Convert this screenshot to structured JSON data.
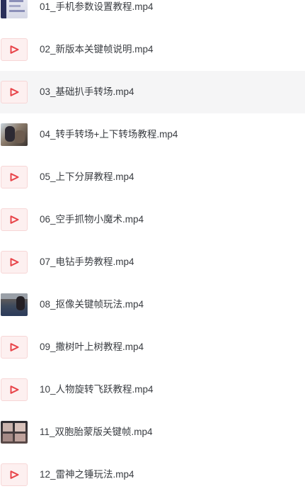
{
  "files": [
    {
      "name": "01_手机参数设置教程.mp4",
      "thumb": "photo",
      "icon": "video-thumbnail-icon"
    },
    {
      "name": "02_新版本关键帧说明.mp4",
      "thumb": "video-icon",
      "icon": "video-file-icon"
    },
    {
      "name": "03_基础扒手转场.mp4",
      "thumb": "video-icon",
      "icon": "video-file-icon",
      "selected": true
    },
    {
      "name": "04_转手转场+上下转场教程.mp4",
      "thumb": "photo",
      "icon": "video-thumbnail-icon"
    },
    {
      "name": "05_上下分屏教程.mp4",
      "thumb": "video-icon",
      "icon": "video-file-icon"
    },
    {
      "name": "06_空手抓物小魔术.mp4",
      "thumb": "video-icon",
      "icon": "video-file-icon"
    },
    {
      "name": "07_电钻手势教程.mp4",
      "thumb": "video-icon",
      "icon": "video-file-icon"
    },
    {
      "name": "08_抠像关键帧玩法.mp4",
      "thumb": "photo",
      "icon": "video-thumbnail-icon"
    },
    {
      "name": "09_撒树叶上树教程.mp4",
      "thumb": "video-icon",
      "icon": "video-file-icon"
    },
    {
      "name": "10_人物旋转飞跃教程.mp4",
      "thumb": "video-icon",
      "icon": "video-file-icon"
    },
    {
      "name": "11_双胞胎蒙版关键帧.mp4",
      "thumb": "photo",
      "icon": "video-thumbnail-icon"
    },
    {
      "name": "12_雷神之锤玩法.mp4",
      "thumb": "video-icon",
      "icon": "video-file-icon"
    }
  ],
  "colors": {
    "text": "#3a3d42",
    "selected_row": "#f5f5f6",
    "video_icon_bg": "#fdf0f0",
    "video_icon_accent": "#e8454a"
  }
}
